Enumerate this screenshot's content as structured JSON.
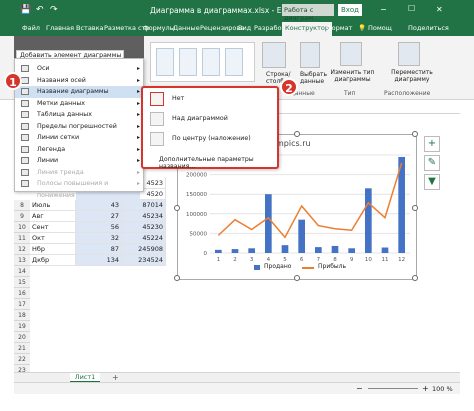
{
  "titlebar": {
    "save_icon": "save-icon",
    "undo_icon": "undo-icon",
    "redo_icon": "redo-icon",
    "title": "Диаграмма в диаграммах.xlsx - Excel",
    "context": "Работа с диаграм...",
    "login": "Вход",
    "window_controls": [
      "−",
      "☐",
      "✕"
    ]
  },
  "tabs": [
    "Файл",
    "Главная",
    "Вставка",
    "Разметка стр",
    "Формулы",
    "Данные",
    "Рецензирова",
    "Вид",
    "Разработчик",
    "Конструктор",
    "Формат"
  ],
  "tabs_right": {
    "help": "Помощ",
    "share": "Поделиться"
  },
  "ribbon": {
    "add_element": "Добавить элемент диаграммы",
    "row_col": "Строка/ столбец",
    "select_data": "Выбрать данные",
    "change_type": "Изменить тип диаграммы",
    "move_chart": "Переместить диаграмму",
    "group_data": "Данные",
    "group_type": "Тип",
    "group_location": "Расположение"
  },
  "menu1": {
    "items": [
      {
        "label": "Оси",
        "disabled": false,
        "has_arrow": true
      },
      {
        "label": "Названия осей",
        "disabled": false,
        "has_arrow": true
      },
      {
        "label": "Название диаграммы",
        "disabled": false,
        "has_arrow": true
      },
      {
        "label": "Метки данных",
        "disabled": false,
        "has_arrow": true
      },
      {
        "label": "Таблица данных",
        "disabled": false,
        "has_arrow": true
      },
      {
        "label": "Пределы погрешностей",
        "disabled": false,
        "has_arrow": true
      },
      {
        "label": "Линии сетки",
        "disabled": false,
        "has_arrow": true
      },
      {
        "label": "Легенда",
        "disabled": false,
        "has_arrow": true
      },
      {
        "label": "Линии",
        "disabled": false,
        "has_arrow": true
      },
      {
        "label": "Линия тренда",
        "disabled": true,
        "has_arrow": true
      },
      {
        "label": "Полосы повышения и понижения",
        "disabled": true,
        "has_arrow": true
      }
    ]
  },
  "menu2": {
    "items": [
      "Нет",
      "Над диаграммой",
      "По центру (наложение)"
    ],
    "more": "Дополнительные параметры названия..."
  },
  "badges": [
    "1",
    "2"
  ],
  "table": {
    "partial": [
      {
        "row": "",
        "a": "",
        "b": "",
        "c": "4523"
      },
      {
        "row": "",
        "a": "",
        "b": "",
        "c": "4520"
      }
    ],
    "rows": [
      {
        "row": "8",
        "a": "Июль",
        "b": "43",
        "c": "87014"
      },
      {
        "row": "9",
        "a": "Авг",
        "b": "27",
        "c": "45234"
      },
      {
        "row": "10",
        "a": "Сент",
        "b": "56",
        "c": "45230"
      },
      {
        "row": "11",
        "a": "Окт",
        "b": "32",
        "c": "45224"
      },
      {
        "row": "12",
        "a": "Нбр",
        "b": "87",
        "c": "245908"
      },
      {
        "row": "13",
        "a": "Дкбр",
        "b": "134",
        "c": "234524"
      }
    ],
    "empty_rows": [
      "14",
      "15",
      "16",
      "17",
      "18",
      "19",
      "20",
      "21",
      "22",
      "23"
    ]
  },
  "chart": {
    "title_fragment": "mpics.ru",
    "yticks": [
      "250000",
      "200000",
      "150000",
      "100000",
      "50000",
      "0"
    ],
    "xticks": [
      "1",
      "2",
      "3",
      "4",
      "5",
      "6",
      "7",
      "8",
      "9",
      "10",
      "11",
      "12"
    ],
    "legend": {
      "bar": "Продано",
      "line": "Прибыль"
    },
    "side_buttons": [
      "+",
      "✎",
      "▼"
    ]
  },
  "chart_data": {
    "type": "bar",
    "categories": [
      "1",
      "2",
      "3",
      "4",
      "5",
      "6",
      "7",
      "8",
      "9",
      "10",
      "11",
      "12"
    ],
    "series": [
      {
        "name": "Продано",
        "type": "bar",
        "values": [
          8000,
          10000,
          12000,
          150000,
          20000,
          85000,
          15000,
          18000,
          12000,
          165000,
          14000,
          245000
        ]
      },
      {
        "name": "Прибыль",
        "type": "line",
        "values": [
          45000,
          85000,
          60000,
          90000,
          40000,
          120000,
          70000,
          62000,
          58000,
          128000,
          90000,
          230000
        ]
      }
    ],
    "ylim": [
      0,
      250000
    ],
    "colors": {
      "bar": "#4472c4",
      "line": "#ed7d31"
    }
  },
  "sheet": {
    "tab": "Лист1",
    "add": "+"
  },
  "status": {
    "zoom": "100 %",
    "minus": "−",
    "plus": "+"
  }
}
